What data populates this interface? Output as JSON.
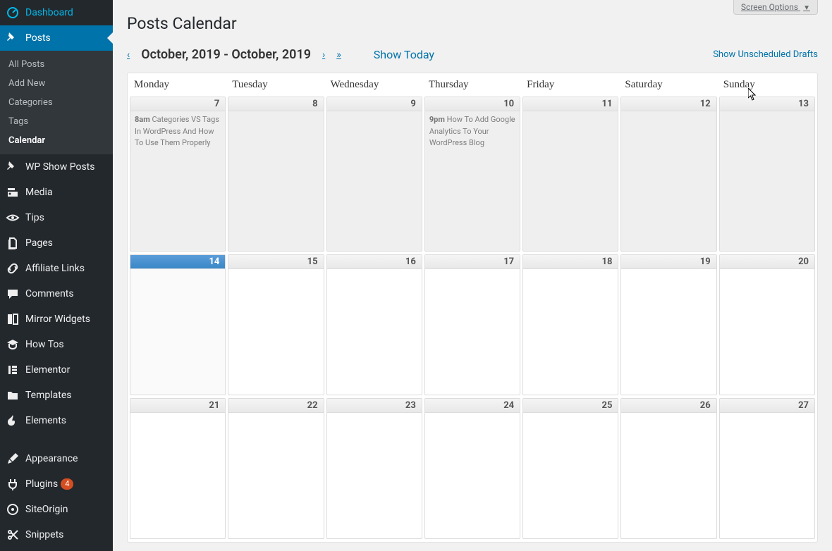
{
  "screen_options_label": "Screen Options",
  "page_title": "Posts Calendar",
  "nav": {
    "prev1": "‹",
    "range": "October, 2019 - October, 2019",
    "next1": "›",
    "next2": "»",
    "show_today": "Show Today",
    "show_drafts": "Show Unscheduled Drafts"
  },
  "sidebar": {
    "items": [
      {
        "label": "Dashboard",
        "icon": "dashboard"
      },
      {
        "label": "Posts",
        "icon": "pin",
        "current": true
      },
      {
        "label": "WP Show Posts",
        "icon": "pin"
      },
      {
        "label": "Media",
        "icon": "media"
      },
      {
        "label": "Tips",
        "icon": "eye"
      },
      {
        "label": "Pages",
        "icon": "pages"
      },
      {
        "label": "Affiliate Links",
        "icon": "link"
      },
      {
        "label": "Comments",
        "icon": "comment"
      },
      {
        "label": "Mirror Widgets",
        "icon": "mirror"
      },
      {
        "label": "How Tos",
        "icon": "grad"
      },
      {
        "label": "Elementor",
        "icon": "elementor"
      },
      {
        "label": "Templates",
        "icon": "folder"
      },
      {
        "label": "Elements",
        "icon": "flame"
      },
      {
        "label": "Appearance",
        "icon": "brush"
      },
      {
        "label": "Plugins",
        "icon": "plugin",
        "badge": "4"
      },
      {
        "label": "SiteOrigin",
        "icon": "siteorigin"
      },
      {
        "label": "Snippets",
        "icon": "scissors"
      }
    ],
    "posts_submenu": [
      "All Posts",
      "Add New",
      "Categories",
      "Tags",
      "Calendar"
    ]
  },
  "day_headers": [
    "Monday",
    "Tuesday",
    "Wednesday",
    "Thursday",
    "Friday",
    "Saturday",
    "Sunday"
  ],
  "weeks": [
    {
      "days": [
        {
          "num": "7",
          "past": true,
          "events": [
            {
              "time": "8am",
              "title": "Categories VS Tags In WordPress And How To Use Them Properly"
            }
          ]
        },
        {
          "num": "8",
          "past": true
        },
        {
          "num": "9",
          "past": true
        },
        {
          "num": "10",
          "past": true,
          "events": [
            {
              "time": "9pm",
              "title": "How To Add Google Analytics To Your WordPress Blog"
            }
          ]
        },
        {
          "num": "11",
          "past": true
        },
        {
          "num": "12",
          "past": true
        },
        {
          "num": "13",
          "past": true
        }
      ]
    },
    {
      "days": [
        {
          "num": "14",
          "today": true
        },
        {
          "num": "15",
          "future": true
        },
        {
          "num": "16",
          "future": true
        },
        {
          "num": "17",
          "future": true
        },
        {
          "num": "18",
          "future": true
        },
        {
          "num": "19",
          "future": true
        },
        {
          "num": "20",
          "future": true
        }
      ]
    },
    {
      "days": [
        {
          "num": "21",
          "future": true
        },
        {
          "num": "22",
          "future": true
        },
        {
          "num": "23",
          "future": true
        },
        {
          "num": "24",
          "future": true
        },
        {
          "num": "25",
          "future": true
        },
        {
          "num": "26",
          "future": true
        },
        {
          "num": "27",
          "future": true
        }
      ]
    }
  ]
}
